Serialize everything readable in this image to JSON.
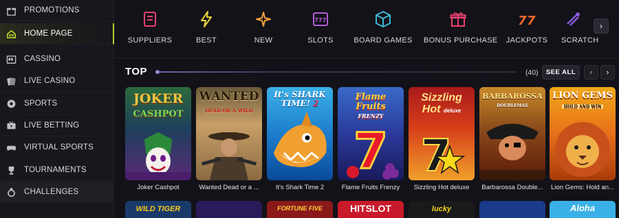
{
  "sidebar": {
    "items": [
      {
        "label": "PROMOTIONS",
        "icon": "gift-icon"
      },
      {
        "label": "HOME PAGE",
        "icon": "home-icon",
        "active": true
      },
      {
        "label": "CASSINO",
        "icon": "slot-machine-icon"
      },
      {
        "label": "LIVE CASINO",
        "icon": "cards-icon"
      },
      {
        "label": "SPORTS",
        "icon": "soccer-ball-icon"
      },
      {
        "label": "LIVE BETTING",
        "icon": "tv-icon"
      },
      {
        "label": "VIRTUAL SPORTS",
        "icon": "gamepad-icon"
      },
      {
        "label": "TOURNAMENTS",
        "icon": "trophy-icon"
      },
      {
        "label": "CHALLENGES",
        "icon": "medal-icon"
      }
    ]
  },
  "categories": [
    {
      "label": "SUPPLIERS",
      "icon": "book-icon",
      "color": "#e8416f"
    },
    {
      "label": "BEST",
      "icon": "lightning-icon",
      "color": "#e7d43a"
    },
    {
      "label": "NEW",
      "icon": "sparkle-icon",
      "color": "#f0a03c"
    },
    {
      "label": "SLOTS",
      "icon": "slot-777-icon",
      "color": "#b65bd8"
    },
    {
      "label": "BOARD GAMES",
      "icon": "dice-icon",
      "color": "#3ab8d8"
    },
    {
      "label": "BONUS PURCHASE",
      "icon": "gift-box-icon",
      "color": "#e8416f"
    },
    {
      "label": "JACKPOTS",
      "icon": "seven-seven-icon",
      "color": "#f06a2c"
    },
    {
      "label": "SCRATCH",
      "icon": "scratch-icon",
      "color": "#8a5bd8"
    }
  ],
  "top": {
    "title": "TOP",
    "count": "(40)",
    "see_all": "SEE ALL",
    "prev": "‹",
    "next": "›"
  },
  "category_scroll": "›",
  "games": [
    {
      "title": "Joker Cashpot",
      "logo": "JOKER\nCASHPOT"
    },
    {
      "title": "Wanted Dead or a ...",
      "logo": "WANTED\nDEAD OR A WILD"
    },
    {
      "title": "It's Shark Time 2",
      "logo": "It's SHARK TIME! 2"
    },
    {
      "title": "Flame Fruits Frenzy",
      "logo": "Flame Fruits\nFRENZY"
    },
    {
      "title": "Sizzling Hot deluxe",
      "logo": "Sizzling\nHot\ndeluxe"
    },
    {
      "title": "Barbarossa Double...",
      "logo": "BARBAROSSA\nDOUBLEMAX"
    },
    {
      "title": "Lion Gems: Hold an...",
      "logo": "LION GEMS\nHOLD AND WIN"
    }
  ],
  "games_row2": [
    "WILD TIGER",
    "",
    "FORTUNE FIVE",
    "HITSLOT",
    "lucky",
    "",
    "Aloha"
  ]
}
